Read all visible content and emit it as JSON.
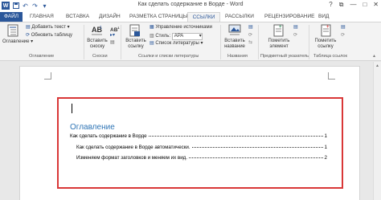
{
  "window": {
    "title": "Как сделать содержание в Ворде - Word",
    "controls": [
      "?",
      "⧉",
      "—",
      "□",
      "✕"
    ]
  },
  "tabs": [
    {
      "label": "ФАЙЛ"
    },
    {
      "label": "ГЛАВНАЯ"
    },
    {
      "label": "ВСТАВКА"
    },
    {
      "label": "ДИЗАЙН"
    },
    {
      "label": "РАЗМЕТКА СТРАНИЦЫ"
    },
    {
      "label": "ССЫЛКИ"
    },
    {
      "label": "РАССЫЛКИ"
    },
    {
      "label": "РЕЦЕНЗИРОВАНИЕ"
    },
    {
      "label": "ВИД"
    }
  ],
  "active_tab": "ССЫЛКИ",
  "ribbon": {
    "toc_group": {
      "big_button": "Оглавление",
      "add_text": "Добавить текст",
      "update_table": "Обновить таблицу",
      "label": "Оглавление"
    },
    "footnotes_group": {
      "insert_footnote_line1": "Вставить",
      "insert_footnote_line2": "сноску",
      "ab_glyph": "AB",
      "label": "Сноски"
    },
    "citations_group": {
      "insert_citation_line1": "Вставить",
      "insert_citation_line2": "ссылку",
      "manage_sources": "Управление источниками",
      "style_label": "Стиль:",
      "style_value": "APA",
      "bibliography": "Список литературы",
      "label": "Ссылки и списки литературы"
    },
    "captions_group": {
      "insert_caption_line1": "Вставить",
      "insert_caption_line2": "название",
      "label": "Названия"
    },
    "index_group": {
      "mark_entry_line1": "Пометить",
      "mark_entry_line2": "элемент",
      "label": "Предметный указатель"
    },
    "authorities_group": {
      "mark_citation_line1": "Пометить",
      "mark_citation_line2": "ссылку",
      "label": "Таблица ссылок"
    }
  },
  "document": {
    "toc_heading": "Оглавление",
    "toc_entries": [
      {
        "text": "Как сделать содержание в Ворде",
        "page": "1"
      },
      {
        "text": "Как сделать содержание в Ворде автоматически.",
        "page": "1"
      },
      {
        "text": "Изменяем формат заголовков и меняем их вид.",
        "page": "2"
      }
    ]
  },
  "colors": {
    "brand": "#2b579a",
    "highlight_border": "#d93737",
    "toc_heading": "#2e74b5"
  }
}
